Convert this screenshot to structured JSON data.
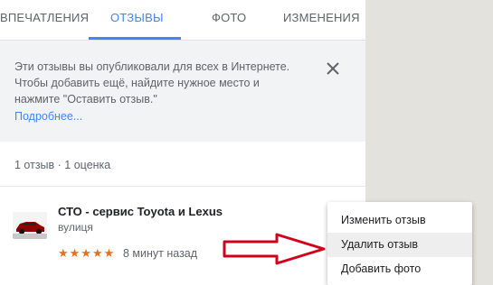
{
  "tabs": [
    {
      "label": "ВПЕЧАТЛЕНИЯ",
      "active": false
    },
    {
      "label": "ОТЗЫВЫ",
      "active": true
    },
    {
      "label": "ФОТО",
      "active": false
    },
    {
      "label": "ИЗМЕНЕНИЯ",
      "active": false
    }
  ],
  "notice": {
    "lines": [
      "Эти отзывы вы опубликовали для всех в Интернете.",
      "Чтобы добавить ещё, найдите нужное место и",
      "нажмите \"Оставить отзыв.\""
    ],
    "link": "Подробнее..."
  },
  "summary": "1 отзыв · 1 оценка",
  "review": {
    "place_name": "СТО  - сервис Toyota и Lexus",
    "address": "вулиця",
    "rating": 5,
    "stars_text": "★★★★★",
    "time": "8 минут назад"
  },
  "menu": {
    "items": [
      {
        "label": "Изменить отзыв"
      },
      {
        "label": "Удалить отзыв",
        "highlighted": true
      },
      {
        "label": "Добавить фото"
      }
    ]
  },
  "colors": {
    "accent": "#4285f4",
    "star": "#e7711b",
    "arrow": "#d0021b"
  }
}
